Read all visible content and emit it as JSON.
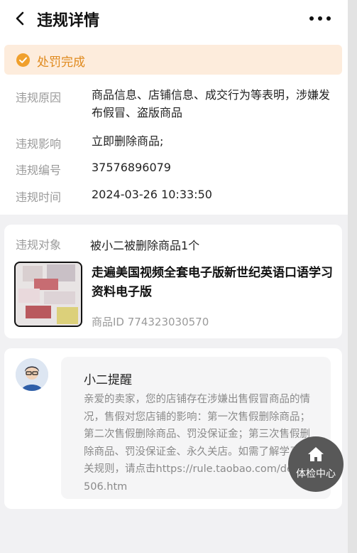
{
  "header": {
    "title": "违规详情",
    "back_icon": "chevron-left-icon",
    "more_icon": "more-dots-icon"
  },
  "status": {
    "text": "处罚完成",
    "icon": "check-circle-icon",
    "color": "#f0a02d",
    "bg": "#fdecdc"
  },
  "details": [
    {
      "label": "违规原因",
      "value": "商品信息、店铺信息、成交行为等表明，涉嫌发布假冒、盗版商品"
    },
    {
      "label": "违规影响",
      "value": "立即删除商品;"
    },
    {
      "label": "违规编号",
      "value": "37576896079"
    },
    {
      "label": "违规时间",
      "value": "2024-03-26 10:33:50"
    }
  ],
  "object": {
    "label": "违规对象",
    "count_text": "被小二被删除商品1个",
    "product_title": "走遍美国视频全套电子版新世纪英语口语学习资料电子版",
    "product_id": "商品ID 774323030570"
  },
  "message": {
    "title": "小二提醒",
    "body": "亲爱的卖家，您的店铺存在涉嫌出售假冒商品的情况，售假对您店铺的影响：第一次售假删除商品；第二次售假删除商品、罚没保证金；第三次售假删除商品、罚没保证金、永久关店。如需了解学习相关规则，请点击https://rule.taobao.com/detail-506.htm"
  },
  "fab": {
    "label": "体检中心",
    "icon": "home-icon"
  }
}
